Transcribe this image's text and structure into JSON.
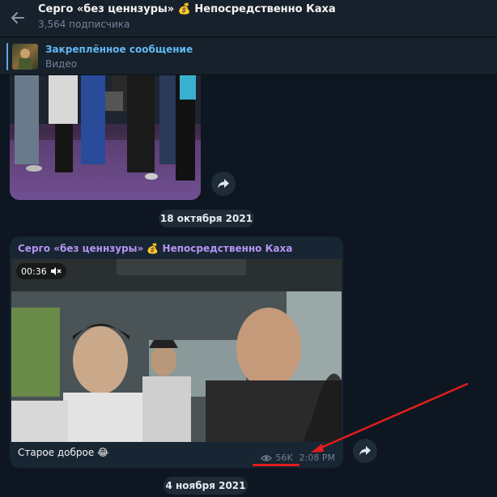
{
  "header": {
    "title": "Серго «без ценнзуры» 💰 Непосредственно Каха",
    "subscribers": "3,564 подписчика"
  },
  "pinned": {
    "title": "Закреплённое сообщение",
    "subtitle": "Видео"
  },
  "messages": {
    "date1": "18 октября 2021",
    "post": {
      "sender": "Серго «без ценнзуры» 💰 Непосредственно Каха",
      "duration": "00:36",
      "caption": "Старое доброе 😂",
      "views": "56K",
      "time": "2:08 PM"
    },
    "date2": "4 ноября 2021"
  },
  "icons": {
    "back": "arrow-left-icon",
    "share": "share-arrow-icon",
    "mute": "speaker-muted-icon",
    "views": "eye-icon"
  },
  "colors": {
    "background": "#0e1621",
    "header": "#17212b",
    "accent": "#62b8f4",
    "sender": "#b595f2",
    "bubble": "#182533",
    "annotation": "#e21d1d"
  }
}
